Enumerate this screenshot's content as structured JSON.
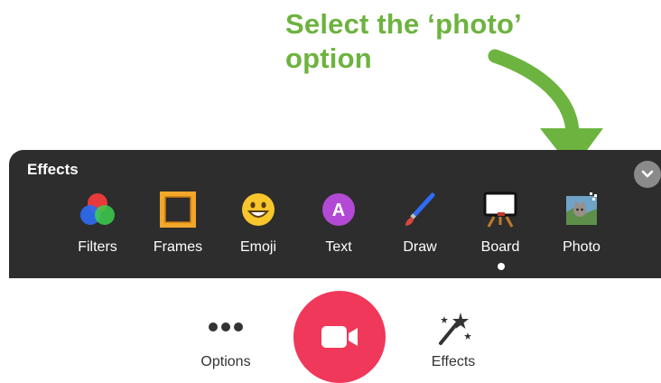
{
  "annotation": {
    "line1": "Select the ‘photo’",
    "line2": "option"
  },
  "panel": {
    "title": "Effects",
    "items": [
      {
        "label": "Filters",
        "icon": "filters-icon"
      },
      {
        "label": "Frames",
        "icon": "frame-icon"
      },
      {
        "label": "Emoji",
        "icon": "emoji-icon"
      },
      {
        "label": "Text",
        "icon": "text-icon"
      },
      {
        "label": "Draw",
        "icon": "brush-icon"
      },
      {
        "label": "Board",
        "icon": "board-icon"
      },
      {
        "label": "Photo",
        "icon": "photo-icon"
      }
    ]
  },
  "bottom": {
    "options_label": "Options",
    "effects_label": "Effects"
  },
  "colors": {
    "annotation": "#6db33f",
    "panel_bg": "#2d2d2d",
    "record": "#f0385a"
  }
}
